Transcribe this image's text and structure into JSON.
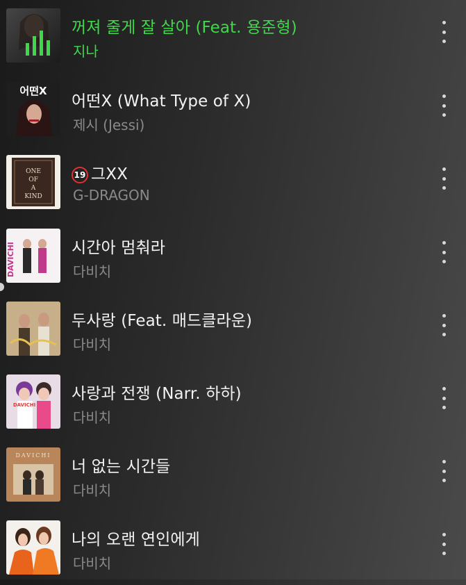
{
  "now_playing_index": 0,
  "colors": {
    "accent": "#3fd84a",
    "title": "#f2f2f2",
    "artist": "#8a8a8a",
    "more_icon": "#d8d8d8",
    "explicit_badge_border": "#e03030"
  },
  "songs": [
    {
      "title": "꺼져 줄게 잘 살아 (Feat. 용준형)",
      "artist": "지나",
      "playing": true,
      "explicit": false,
      "art_icon": "album-art-portrait"
    },
    {
      "title": "어떤X (What Type of X)",
      "artist": "제시 (Jessi)",
      "playing": false,
      "explicit": false,
      "art_icon": "album-art-portrait"
    },
    {
      "title": "그XX",
      "artist": "G-DRAGON",
      "playing": false,
      "explicit": true,
      "explicit_label": "19",
      "art_icon": "album-art-one-of-a-kind"
    },
    {
      "title": "시간아 멈춰라",
      "artist": "다비치",
      "playing": false,
      "explicit": false,
      "art_icon": "album-art-davichi"
    },
    {
      "title": "두사랑 (Feat. 매드클라운)",
      "artist": "다비치",
      "playing": false,
      "explicit": false,
      "art_icon": "album-art-davichi"
    },
    {
      "title": "사랑과 전쟁 (Narr. 하하)",
      "artist": "다비치",
      "playing": false,
      "explicit": false,
      "art_icon": "album-art-davichi"
    },
    {
      "title": "너 없는 시간들",
      "artist": "다비치",
      "playing": false,
      "explicit": false,
      "art_icon": "album-art-davichi"
    },
    {
      "title": "나의 오랜 연인에게",
      "artist": "다비치",
      "playing": false,
      "explicit": false,
      "art_icon": "album-art-davichi"
    }
  ],
  "album_art_labels": {
    "art2": "어떤X",
    "art3_lines": [
      "ONE",
      "OF",
      "A",
      "KIND"
    ],
    "art4": "DAVICHI",
    "art6": "DAVICHI",
    "art7": "DAVICHI"
  }
}
